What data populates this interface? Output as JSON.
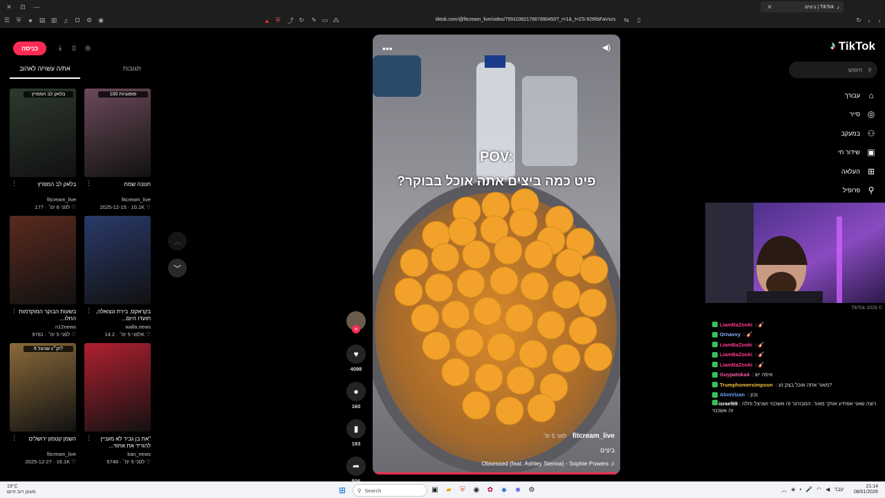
{
  "browser": {
    "tab_title": "ביצים | TikTok",
    "url": "tiktok.com/@fitcream_live/video/7591038217667890450?_r=1&_t=ZS-92tRbFaVxzs"
  },
  "left_panel": {
    "login_label": "כניסה",
    "tabs": [
      {
        "label": "את/ה עשוי/ה לאהוב",
        "active": true
      },
      {
        "label": "תגובות",
        "active": false
      }
    ],
    "cards": [
      {
        "title": "בלאק לב המפרץ",
        "tag": "בלאק לב המפרץ",
        "author": "fitcream_live",
        "likes": "177",
        "time": "לפני 6 ימ׳",
        "thumb_color": "#2e3a2e"
      },
      {
        "title": "חנוכה שמח",
        "tag": "100 סופגניות",
        "author": "fitcream_live",
        "likes": "10.1K",
        "time": "2025-12-15",
        "thumb_color": "#6b4a5a"
      },
      {
        "title": "בשעות הבוקר המוקדמות החלו...",
        "tag": "",
        "author": "n12news",
        "likes": "9781",
        "time": "לפני 5 ימ׳",
        "thumb_color": "#5a2a1e"
      },
      {
        "title": "בקראקס, בירת ונצואלה, תועדו היום...",
        "tag": "",
        "author": "walla.news",
        "likes": "14.2K",
        "time": "לפני 5 ימ׳",
        "thumb_color": "#2a3a6a"
      },
      {
        "title": "השמן קטמון ירושלים",
        "tag": "6 ק״ג שניצל!?",
        "author": "fitcream_live",
        "likes": "16.1K",
        "time": "2025-12-27",
        "thumb_color": "#8a6a3a"
      },
      {
        "title": "\"את בן גביר לא מעניין להוריד את אחוזי...",
        "tag": "",
        "author": "kan_news",
        "likes": "6748",
        "time": "לפני 5 ימ׳",
        "thumb_color": "#b02030"
      }
    ]
  },
  "video": {
    "caption_line1": "POV:",
    "caption_line2": "פיט כמה ביצים אתה אוכל בבוקר?",
    "author": "fitcream_live",
    "time": "לפני 5 ימ׳",
    "description": "ביצים",
    "music": "Obsessed (feat. Ashley Sienna) - Sophie Powers",
    "progress": 0.99
  },
  "actions": {
    "likes": "4098",
    "comments": "160",
    "saves": "193",
    "shares": "506"
  },
  "sidebar": {
    "logo": "TikTok",
    "search_placeholder": "חיפוש",
    "nav": [
      {
        "label": "עבורך",
        "icon": "home-icon",
        "glyph": "⌂"
      },
      {
        "label": "סייר",
        "icon": "compass-icon",
        "glyph": "◎"
      },
      {
        "label": "במעקב",
        "icon": "following-icon",
        "glyph": "⚇"
      },
      {
        "label": "שידור חי",
        "icon": "live-icon",
        "glyph": "▣"
      },
      {
        "label": "העלאה",
        "icon": "upload-icon",
        "glyph": "⊞"
      },
      {
        "label": "פרופיל",
        "icon": "profile-icon",
        "glyph": "⚲"
      }
    ],
    "copyright": "TikTok 2026 ©"
  },
  "chat": [
    {
      "user": "LiamBaZooki",
      "msg": "🎸",
      "color": "#ff3a8a"
    },
    {
      "user": "Ornavvy",
      "msg": "🎸",
      "color": "#8ab4ff"
    },
    {
      "user": "LiamBaZooki",
      "msg": "🎸",
      "color": "#ff3a8a"
    },
    {
      "user": "LiamBaZooki",
      "msg": "🎸",
      "color": "#ff3a8a"
    },
    {
      "user": "LiamBaZooki",
      "msg": "🎸",
      "color": "#ff3a8a"
    },
    {
      "user": "Guypatoka4",
      "msg": "איפה יש",
      "color": "#ff5aa8"
    },
    {
      "user": "Trumphomersimpson",
      "msg": "מאור אתה אוכל בצק נע?",
      "color": "#f0c040"
    },
    {
      "user": "AlonVizan",
      "msg": "נכון",
      "color": "#6aa8ff"
    },
    {
      "user": "israel69",
      "msg": "רוצה שאני אפתיע אותך מאור. המבורגר זה אשכנזי ושניצל וחלה זה אשכנזי",
      "color": "#ffffff"
    }
  ],
  "taskbar": {
    "temp": "19°C",
    "weather": "מעונן רוב היום",
    "search_label": "Search",
    "time": "21:14",
    "date": "08/01/2026",
    "lang": "עבר"
  }
}
